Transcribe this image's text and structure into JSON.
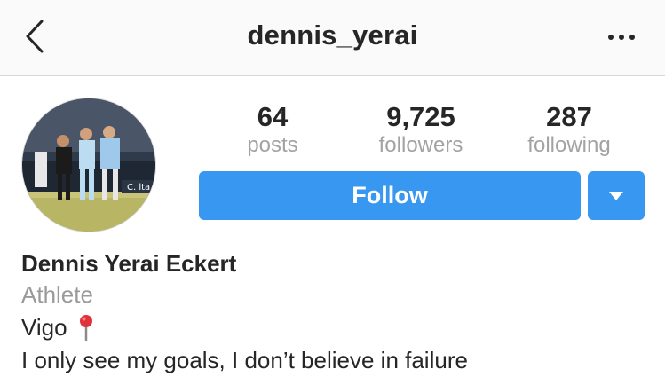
{
  "header": {
    "username": "dennis_yerai",
    "back_icon": "chevron-left-icon",
    "more_icon": "more-horizontal-icon"
  },
  "profile": {
    "avatar_icon": "profile-photo",
    "stats": [
      {
        "value": "64",
        "label": "posts"
      },
      {
        "value": "9,725",
        "label": "followers"
      },
      {
        "value": "287",
        "label": "following"
      }
    ],
    "follow_label": "Follow",
    "dropdown_icon": "caret-down-icon"
  },
  "bio": {
    "name": "Dennis Yerai Eckert",
    "category": "Athlete",
    "location": "Vigo",
    "location_icon": "round-pushpin-icon",
    "text": "I only see my goals, I don’t believe in failure"
  },
  "colors": {
    "accent": "#3897f0",
    "text": "#262626",
    "muted": "#9a9a9a"
  }
}
